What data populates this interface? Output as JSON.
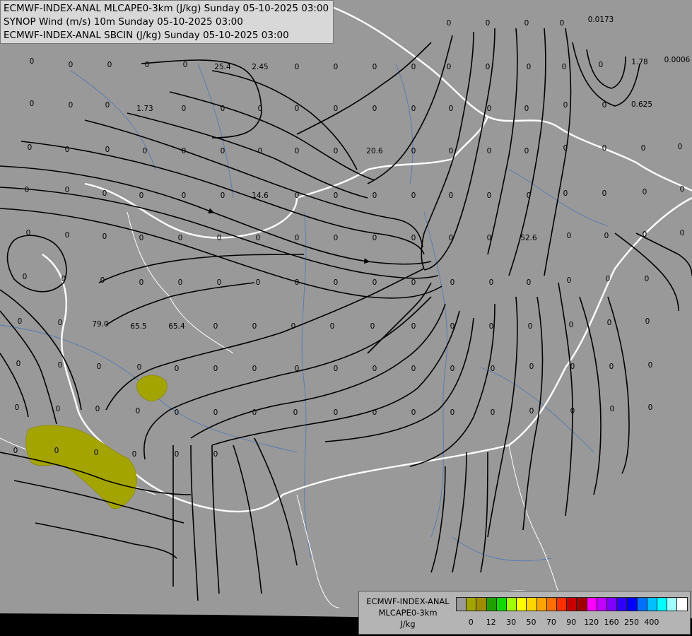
{
  "header": {
    "line1": "ECMWF-INDEX-ANAL MLCAPE0-3km (J/kg) Sunday 05-10-2025 03:00",
    "line2": "SYNOP Wind (m/s) 10m Sunday 05-10-2025 03:00",
    "line3": "ECMWF-INDEX-ANAL SBCIN (J/kg) Sunday 05-10-2025 03:00"
  },
  "legend": {
    "title1": "ECMWF-INDEX-ANAL",
    "title2": "MLCAPE0-3km",
    "units": "J/kg",
    "colors": [
      "#999999",
      "#a4a400",
      "#a08c00",
      "#1ea000",
      "#10d800",
      "#a0ff00",
      "#ffff00",
      "#ffd700",
      "#ffa500",
      "#ff7000",
      "#ff3000",
      "#c80000",
      "#a00000",
      "#ff00ff",
      "#c000ff",
      "#8000ff",
      "#3000ff",
      "#0000ff",
      "#0070ff",
      "#00c0ff",
      "#00ffff",
      "#a0ffff",
      "#ffffff"
    ],
    "ticks": [
      "0",
      "12",
      "30",
      "50",
      "70",
      "90",
      "120",
      "160",
      "250",
      "400"
    ]
  },
  "map_values": [
    "0",
    "0",
    "0",
    "0",
    "0",
    "0",
    "0",
    "0.0173",
    "0",
    "0",
    "0",
    "0",
    "25.4",
    "2.45",
    "0",
    "0",
    "0",
    "0",
    "0",
    "0",
    "1.78",
    "0.0006",
    "0",
    "0",
    "0",
    "0",
    "0",
    "0",
    "0",
    "0",
    "0",
    "0",
    "0",
    "1.73",
    "0",
    "0",
    "0",
    "0",
    "0",
    "0",
    "0",
    "0",
    "0",
    "0",
    "0",
    "0",
    "0.625",
    "0",
    "0",
    "0",
    "0",
    "0",
    "0",
    "0",
    "0",
    "0",
    "20.6",
    "0",
    "0",
    "0",
    "0",
    "0",
    "0",
    "0",
    "0",
    "0",
    "0",
    "0",
    "0",
    "0",
    "0",
    "14.6",
    "0",
    "0",
    "0",
    "0",
    "0",
    "0",
    "0",
    "0",
    "0",
    "0",
    "0",
    "0",
    "0",
    "0",
    "0",
    "0",
    "0",
    "0",
    "0",
    "0",
    "0",
    "0",
    "0",
    "0",
    "52.6",
    "0",
    "0",
    "0",
    "0",
    "0",
    "0",
    "0",
    "0",
    "0",
    "0",
    "0",
    "0",
    "0",
    "0",
    "0",
    "0",
    "0",
    "0",
    "0",
    "0",
    "0",
    "0",
    "0",
    "79.0",
    "65.5",
    "65.4",
    "0",
    "0",
    "0",
    "0",
    "0",
    "0",
    "0",
    "0",
    "0",
    "0",
    "0",
    "0",
    "0",
    "0",
    "0",
    "0",
    "0",
    "0",
    "0",
    "0",
    "0",
    "0",
    "0",
    "0",
    "0",
    "0",
    "0",
    "0",
    "0",
    "0",
    "0",
    "0",
    "0",
    "0",
    "0",
    "0",
    "0",
    "0",
    "0",
    "0",
    "0",
    "0",
    "0",
    "0",
    "0",
    "0",
    "0",
    "0",
    "0",
    "0",
    "0",
    "0"
  ]
}
